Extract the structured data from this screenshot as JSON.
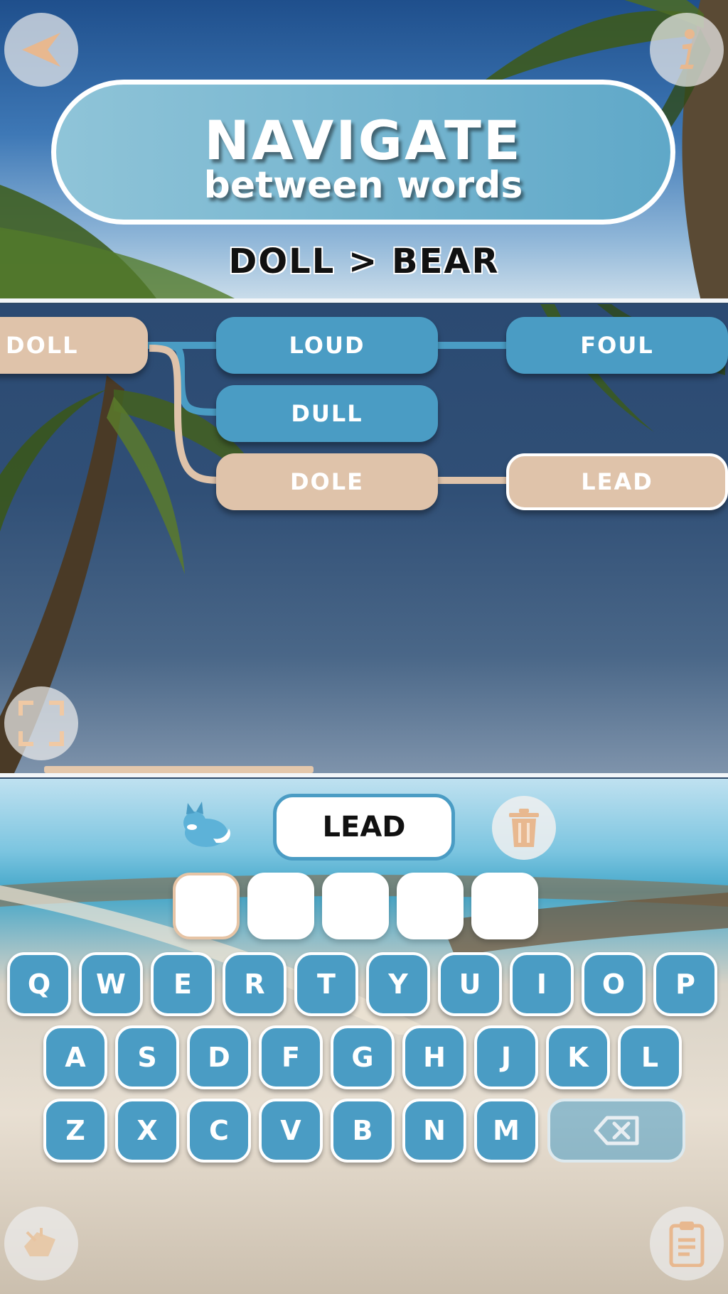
{
  "banner": {
    "title": "NAVIGATE",
    "subtitle": "between words"
  },
  "puzzle": {
    "label": "DOLL > BEAR"
  },
  "tree": {
    "nodes": [
      {
        "id": "doll",
        "word": "DOLL"
      },
      {
        "id": "loud",
        "word": "LOUD"
      },
      {
        "id": "foul",
        "word": "FOUL"
      },
      {
        "id": "dull",
        "word": "DULL"
      },
      {
        "id": "dole",
        "word": "DOLE"
      },
      {
        "id": "lead",
        "word": "LEAD"
      }
    ]
  },
  "progress": {
    "fraction": 0.37
  },
  "input": {
    "current_word": "LEAD",
    "slots": [
      "",
      "",
      "",
      "",
      ""
    ]
  },
  "keyboard": {
    "row1": [
      "Q",
      "W",
      "E",
      "R",
      "T",
      "Y",
      "U",
      "I",
      "O",
      "P"
    ],
    "row2": [
      "A",
      "S",
      "D",
      "F",
      "G",
      "H",
      "J",
      "K",
      "L"
    ],
    "row3": [
      "Z",
      "X",
      "C",
      "V",
      "B",
      "N",
      "M"
    ]
  },
  "icons": {
    "back": "back-arrow-icon",
    "info": "info-icon",
    "fullscreen": "fullscreen-icon",
    "trash": "trash-icon",
    "backspace": "backspace-icon",
    "hint": "hint-icon",
    "clipboard": "clipboard-icon"
  },
  "colors": {
    "path_blue": "#4a9cc4",
    "path_sand": "#dfc3aa",
    "accent": "#e8b88f"
  }
}
